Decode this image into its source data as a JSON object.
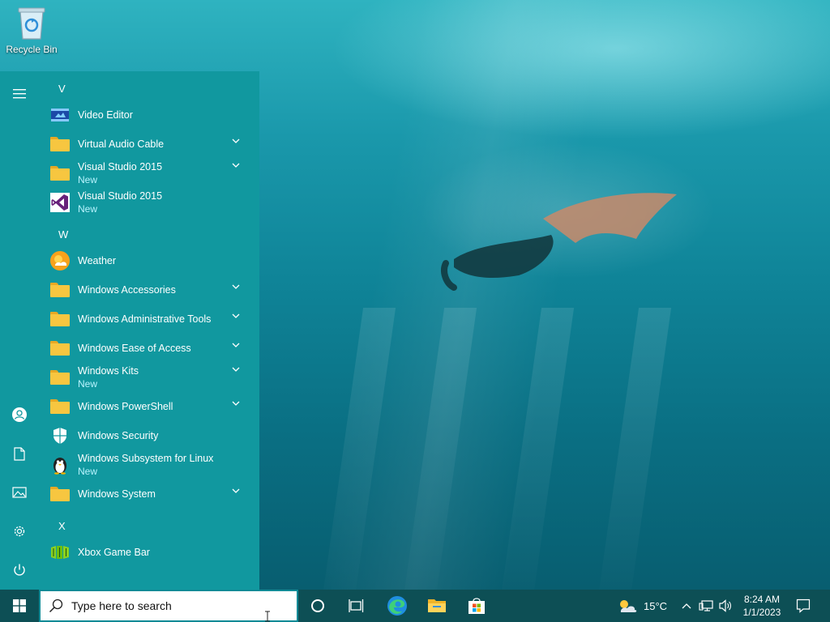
{
  "desktop": {
    "icons": [
      {
        "label": "Recycle Bin",
        "icon": "recycle-bin-icon"
      }
    ]
  },
  "start_menu": {
    "rail": [
      "hamburger-menu-icon",
      "user-account-icon",
      "documents-icon",
      "pictures-icon",
      "settings-gear-icon",
      "power-icon"
    ],
    "groups": [
      {
        "letter": "V"
      },
      {
        "letter": "W"
      },
      {
        "letter": "X"
      }
    ],
    "apps": [
      {
        "name": "Video Editor",
        "icon": "video-editor-icon"
      },
      {
        "name": "Virtual Audio Cable",
        "icon": "folder-icon",
        "expandable": true
      },
      {
        "name": "Visual Studio 2015",
        "sub": "New",
        "icon": "folder-icon",
        "expandable": true
      },
      {
        "name": "Visual Studio 2015",
        "sub": "New",
        "icon": "visual-studio-icon"
      },
      {
        "name": "Weather",
        "icon": "weather-icon"
      },
      {
        "name": "Windows Accessories",
        "icon": "folder-icon",
        "expandable": true
      },
      {
        "name": "Windows Administrative Tools",
        "icon": "folder-icon",
        "expandable": true
      },
      {
        "name": "Windows Ease of Access",
        "icon": "folder-icon",
        "expandable": true
      },
      {
        "name": "Windows Kits",
        "sub": "New",
        "icon": "folder-icon",
        "expandable": true
      },
      {
        "name": "Windows PowerShell",
        "icon": "folder-icon",
        "expandable": true
      },
      {
        "name": "Windows Security",
        "icon": "shield-icon"
      },
      {
        "name": "Windows Subsystem for Linux",
        "sub": "New",
        "icon": "linux-penguin-icon"
      },
      {
        "name": "Windows System",
        "icon": "folder-icon",
        "expandable": true
      },
      {
        "name": "Xbox Game Bar",
        "icon": "xbox-game-bar-icon"
      }
    ]
  },
  "taskbar": {
    "search_placeholder": "Type here to search",
    "pinned": [
      "cortana-icon",
      "task-view-icon",
      "edge-icon",
      "file-explorer-icon",
      "microsoft-store-icon"
    ],
    "weather": {
      "temp": "15°C",
      "icon": "partly-cloudy-icon"
    },
    "clock": {
      "time": "8:24 AM",
      "date": "1/1/2023"
    },
    "colors": {
      "taskbar": "#0d4f55",
      "start_menu": "#11989f",
      "accent": "#0c8a96"
    }
  }
}
